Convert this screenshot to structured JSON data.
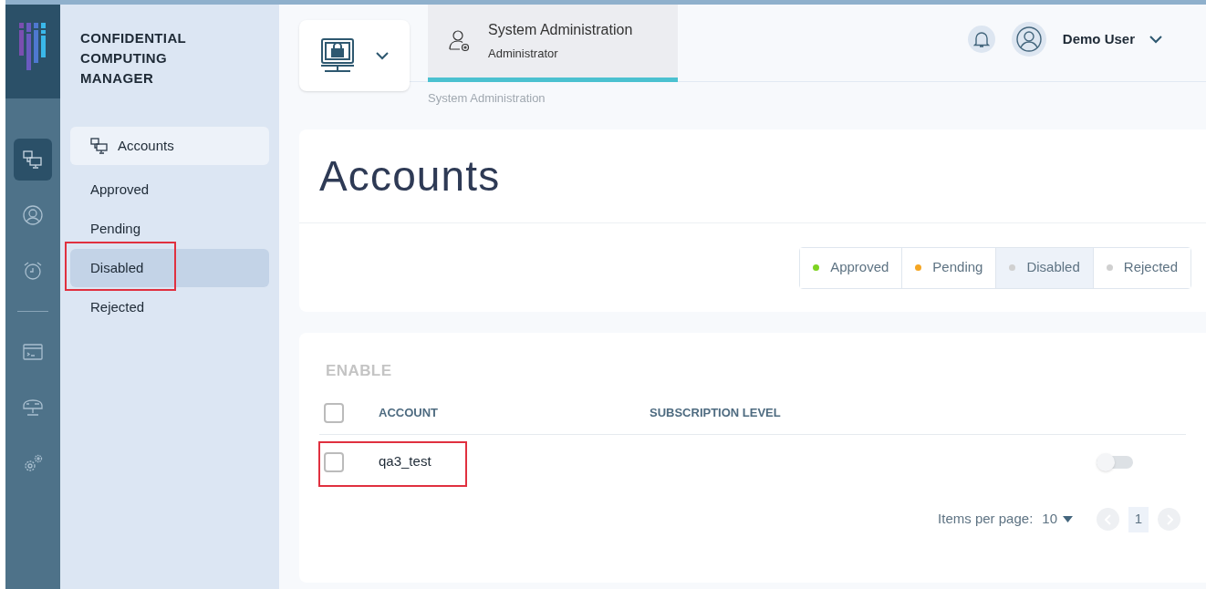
{
  "app": {
    "title_lines": [
      "CONFIDENTIAL",
      "COMPUTING",
      "MANAGER"
    ]
  },
  "rail": {
    "groups": [
      [
        {
          "kind": "accounts",
          "selected": true
        },
        {
          "kind": "user",
          "selected": false
        },
        {
          "kind": "alarm",
          "selected": false
        }
      ],
      [
        {
          "kind": "terminal",
          "selected": false
        },
        {
          "kind": "router",
          "selected": false
        },
        {
          "kind": "gears",
          "selected": false
        }
      ]
    ]
  },
  "sidebar": {
    "heading": "Accounts",
    "items": [
      {
        "label": "Approved",
        "selected": false,
        "highlighted": false
      },
      {
        "label": "Pending",
        "selected": false,
        "highlighted": false
      },
      {
        "label": "Disabled",
        "selected": true,
        "highlighted": true
      },
      {
        "label": "Rejected",
        "selected": false,
        "highlighted": false
      }
    ]
  },
  "header": {
    "tab": {
      "title": "System Administration",
      "subtitle": "Administrator",
      "selected": true
    },
    "breadcrumb": "System Administration",
    "user": "Demo User"
  },
  "page_title": "Accounts",
  "filters": [
    {
      "label": "Approved",
      "color": "#7ed321",
      "selected": false
    },
    {
      "label": "Pending",
      "color": "#f5a623",
      "selected": false
    },
    {
      "label": "Disabled",
      "color": "#d0d0d0",
      "selected": true
    },
    {
      "label": "Rejected",
      "color": "#d0d0d0",
      "selected": false
    }
  ],
  "table": {
    "action": "ENABLE",
    "columns": [
      "ACCOUNT",
      "SUBSCRIPTION LEVEL"
    ],
    "header_checked": false,
    "rows": [
      {
        "account": "qa3_test",
        "checked": false,
        "on": false,
        "highlighted": true
      }
    ]
  },
  "pagination": {
    "items_per_page_label": "Items per page:",
    "items_per_page": "10",
    "pages": [
      {
        "label": "1",
        "selected": true
      }
    ]
  }
}
